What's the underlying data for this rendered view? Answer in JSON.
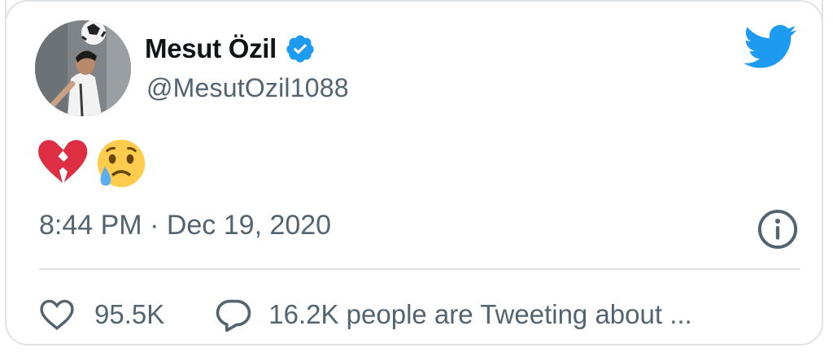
{
  "tweet": {
    "display_name": "Mesut Özil",
    "handle": "@MesutOzil1088",
    "verified": true,
    "text_emojis": [
      "broken-heart",
      "crying-face"
    ],
    "timestamp": "8:44 PM · Dec 19, 2020",
    "likes": "95.5K",
    "tweeting_text": "16.2K people are Tweeting about ..."
  },
  "icons": {
    "brand": "twitter-bird-icon",
    "verified": "verified-badge-icon",
    "info": "info-icon",
    "like": "heart-outline-icon",
    "reply": "speech-bubble-icon"
  },
  "colors": {
    "brand_blue": "#1d9bf0",
    "text_primary": "#0f1419",
    "text_secondary": "#536471",
    "divider": "#dfe3e6",
    "broken_heart": "#dd2e44",
    "emoji_face": "#ffcc4d",
    "tear": "#5dadec"
  }
}
